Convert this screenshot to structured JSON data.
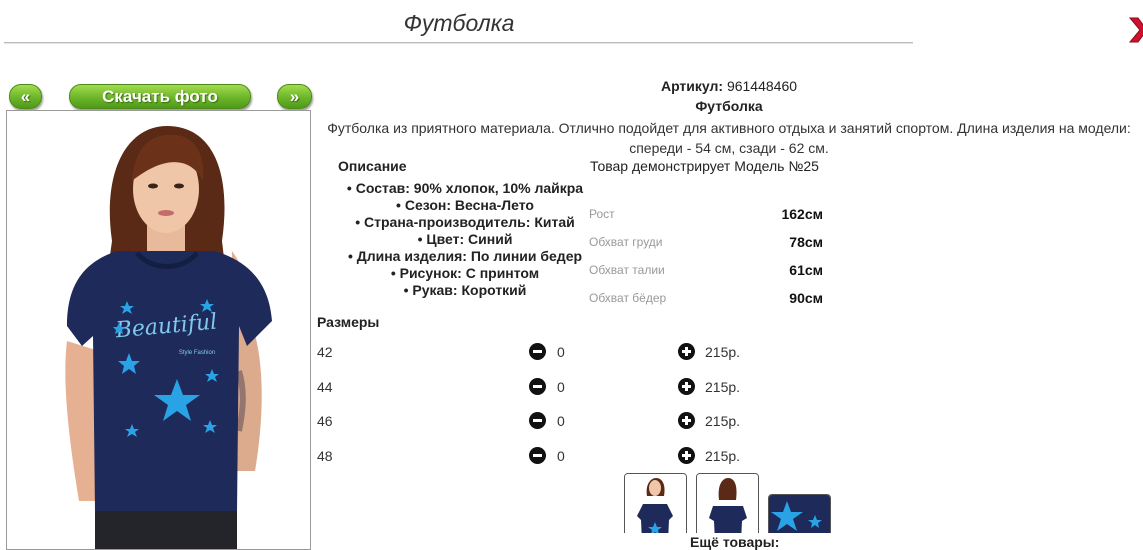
{
  "header": {
    "title": "Футболка"
  },
  "nav": {
    "prev_label": "«",
    "download_label": "Скачать фото",
    "next_label": "»"
  },
  "product": {
    "article_label": "Артикул:",
    "article_value": "961448460",
    "name": "Футболка",
    "description": "Футболка из приятного материала. Отлично подойдет для активного отдыха и занятий спортом. Длина изделия на модели: спереди - 54 см, сзади - 62 см."
  },
  "details": {
    "heading": "Описание",
    "attributes": [
      "Состав: 90% хлопок, 10% лайкра",
      "Сезон: Весна-Лето",
      "Страна-производитель: Китай",
      "Цвет: Синий",
      "Длина изделия: По линии бедер",
      "Рисунок: С принтом",
      "Рукав: Короткий"
    ]
  },
  "model": {
    "note": "Товар демонстрирует Модель №25",
    "measurements": [
      {
        "label": "Рост",
        "value": "162см"
      },
      {
        "label": "Обхват груди",
        "value": "78см"
      },
      {
        "label": "Обхват талии",
        "value": "61см"
      },
      {
        "label": "Обхват бёдер",
        "value": "90см"
      }
    ]
  },
  "sizes": {
    "heading": "Размеры",
    "rows": [
      {
        "size": "42",
        "qty": "0",
        "price": "215р."
      },
      {
        "size": "44",
        "qty": "0",
        "price": "215р."
      },
      {
        "size": "46",
        "qty": "0",
        "price": "215р."
      },
      {
        "size": "48",
        "qty": "0",
        "price": "215р."
      }
    ]
  },
  "more_label": "Ещё товары:",
  "print_text": {
    "main": "Beautiful",
    "sub": "Style Fashion"
  },
  "colors": {
    "accent_green": "#6cb52a",
    "close_red": "#d0112b",
    "shirt_navy": "#1e2a5a",
    "star_blue": "#2aa3e6"
  },
  "icons": {
    "close": "close-x-icon",
    "minus": "minus-circle-icon",
    "plus": "plus-circle-icon"
  }
}
